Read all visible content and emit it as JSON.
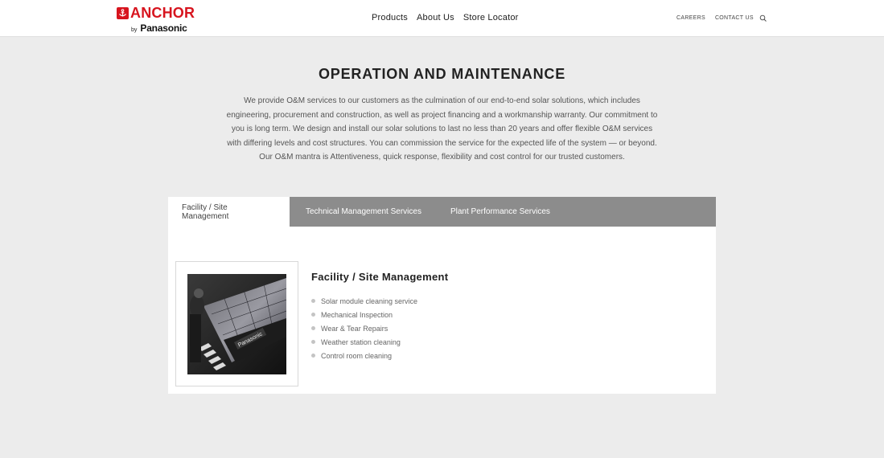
{
  "header": {
    "brand": "ANCHOR",
    "brand_by": "by",
    "brand_parent": "Panasonic",
    "nav": [
      "Products",
      "About Us",
      "Store Locator"
    ],
    "utility_nav": [
      "CAREERS",
      "CONTACT US"
    ],
    "search_icon": "search-icon"
  },
  "main": {
    "title": "OPERATION AND MAINTENANCE",
    "intro_lines": [
      "We provide O&M services to our customers as the culmination of our end-to-end solar solutions, which includes",
      "engineering, procurement and construction, as well as project financing and a workmanship warranty. Our commitment to",
      "you is long term. We design and install our solar solutions to last no less than 20 years and offer flexible O&M services",
      "with differing levels and cost structures. You can commission the service for the expected life of the system — or beyond.",
      "Our O&M mantra is Attentiveness, quick response, flexibility and cost control for our trusted customers."
    ],
    "tabs": [
      {
        "label": "Facility / Site Management",
        "active": true
      },
      {
        "label": "Technical Management Services",
        "active": false
      },
      {
        "label": "Plant Performance Services",
        "active": false
      }
    ],
    "panel": {
      "heading": "Facility / Site Management",
      "image_text": "Panasonic",
      "items": [
        "Solar module cleaning service",
        "Mechanical Inspection",
        "Wear & Tear Repairs",
        "Weather station cleaning",
        "Control room cleaning"
      ]
    }
  },
  "colors": {
    "brand_red": "#d7141e",
    "page_bg": "#ececec",
    "tab_bar": "#8c8c8c"
  }
}
